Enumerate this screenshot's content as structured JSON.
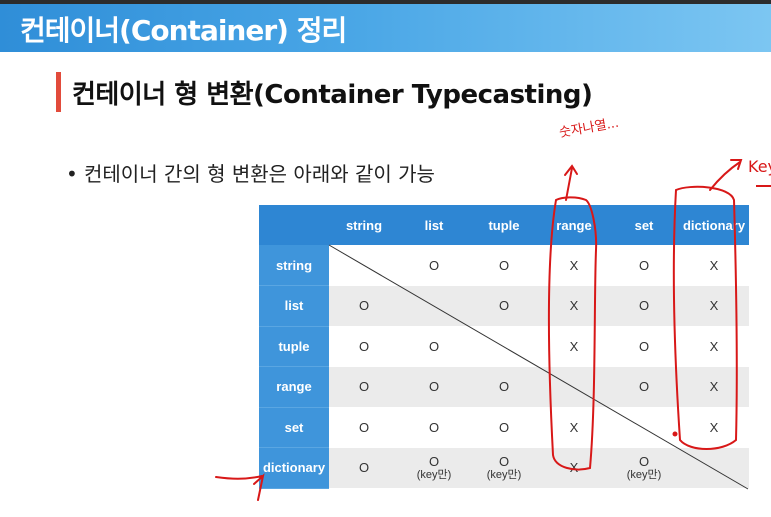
{
  "header": {
    "title": "컨테이너(Container) 정리"
  },
  "section": {
    "title": "컨테이너 형 변환(Container Typecasting)"
  },
  "bullet": {
    "marker": "•",
    "text": "컨테이너 간의 형 변환은 아래와 같이 가능"
  },
  "table": {
    "corner": "",
    "columns": [
      "string",
      "list",
      "tuple",
      "range",
      "set",
      "dictionary"
    ],
    "rows": [
      {
        "label": "string",
        "cells": [
          "",
          "O",
          "O",
          "X",
          "O",
          "X"
        ]
      },
      {
        "label": "list",
        "cells": [
          "O",
          "",
          "O",
          "X",
          "O",
          "X"
        ]
      },
      {
        "label": "tuple",
        "cells": [
          "O",
          "O",
          "",
          "X",
          "O",
          "X"
        ]
      },
      {
        "label": "range",
        "cells": [
          "O",
          "O",
          "O",
          "",
          "O",
          "X"
        ]
      },
      {
        "label": "set",
        "cells": [
          "O",
          "O",
          "O",
          "X",
          "",
          "X"
        ]
      },
      {
        "label": "dictionary",
        "cells": [
          "O",
          "O\n(key만)",
          "O\n(key만)",
          "X",
          "O\n(key만)",
          ""
        ]
      }
    ]
  },
  "annotations": {
    "note_range": "숫자나열...",
    "note_dict": "Key"
  },
  "colors": {
    "header_blue": "#2f8ed8",
    "table_header": "#2e86d3",
    "accent_red": "#e24b3b",
    "pen_red": "#d81818"
  }
}
